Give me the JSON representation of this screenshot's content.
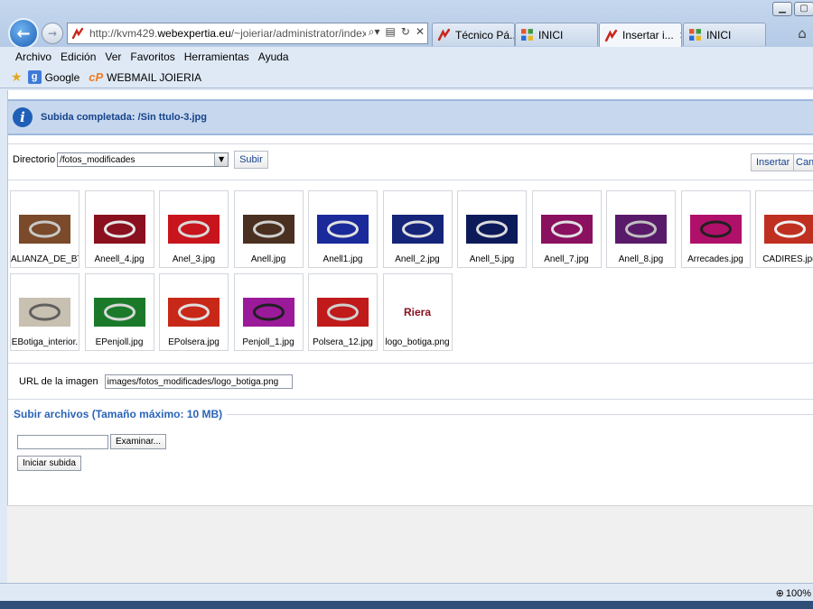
{
  "browser": {
    "address_url_prefix": "http://kvm429.",
    "address_url_domain": "webexpertia.eu",
    "address_url_suffix": "/~joieriar/administrator/index",
    "tabs": [
      {
        "label": "Técnico Pá...",
        "icon": "joomla-icon"
      },
      {
        "label": "INICI",
        "icon": "inici-icon"
      },
      {
        "label": "Insertar i...",
        "icon": "joomla-icon",
        "active": true,
        "close": "✕"
      },
      {
        "label": "INICI",
        "icon": "inici-icon"
      }
    ]
  },
  "menubar": [
    "Archivo",
    "Edición",
    "Ver",
    "Favoritos",
    "Herramientas",
    "Ayuda"
  ],
  "favorites": [
    {
      "label": "Google",
      "icon": "google-icon"
    },
    {
      "label": "WEBMAIL JOIERIA",
      "icon": "cpanel-icon"
    }
  ],
  "message": {
    "text": "Subida completada: /Sin ttulo-3.jpg"
  },
  "directory": {
    "label": "Directorio",
    "selected": "/fotos_modificades",
    "up_button": "Subir",
    "insert_button": "Insertar",
    "cancel_button": "Cancel"
  },
  "images": [
    {
      "name": "ALIANZA_DE_BT",
      "bg": "#7a4a2a",
      "fg": "#c8c8c8"
    },
    {
      "name": "Aneell_4.jpg",
      "bg": "#8a1020",
      "fg": "#e6e6e6"
    },
    {
      "name": "Anel_3.jpg",
      "bg": "#c8141c",
      "fg": "#d9d9d9"
    },
    {
      "name": "Anell.jpg",
      "bg": "#4a3020",
      "fg": "#d0d0d0"
    },
    {
      "name": "Anell1.jpg",
      "bg": "#1a2a9a",
      "fg": "#e0e0e0"
    },
    {
      "name": "Anell_2.jpg",
      "bg": "#15257a",
      "fg": "#e0e0e0"
    },
    {
      "name": "Anell_5.jpg",
      "bg": "#0c1a5a",
      "fg": "#dadada"
    },
    {
      "name": "Anell_7.jpg",
      "bg": "#8a1060",
      "fg": "#e0e0e0"
    },
    {
      "name": "Anell_8.jpg",
      "bg": "#5a1a6a",
      "fg": "#c0c0c0"
    },
    {
      "name": "Arrecades.jpg",
      "bg": "#b0106a",
      "fg": "#202020"
    },
    {
      "name": "CADIRES.jpg",
      "bg": "#c03020",
      "fg": "#f0f0f0"
    },
    {
      "name": "EBotiga_interior.",
      "bg": "#c8c0b0",
      "fg": "#606060"
    },
    {
      "name": "EPenjoll.jpg",
      "bg": "#1a7a2a",
      "fg": "#d8d8d8"
    },
    {
      "name": "EPolsera.jpg",
      "bg": "#c82818",
      "fg": "#e0e0e0"
    },
    {
      "name": "Penjoll_1.jpg",
      "bg": "#9a1a9a",
      "fg": "#202020"
    },
    {
      "name": "Polsera_12.jpg",
      "bg": "#c01a1a",
      "fg": "#d0d0d0"
    },
    {
      "name": "logo_botiga.png",
      "bg": "#ffffff",
      "fg": "#8a1020",
      "logo_text": "Riera"
    }
  ],
  "url_field": {
    "label": "URL de la imagen",
    "value": "images/fotos_modificades/logo_botiga.png"
  },
  "upload": {
    "legend": "Subir archivos (Tamaño máximo: 10 MB)",
    "browse_button": "Examinar...",
    "start_button": "Iniciar subida"
  },
  "status": {
    "zoom": "100%"
  }
}
